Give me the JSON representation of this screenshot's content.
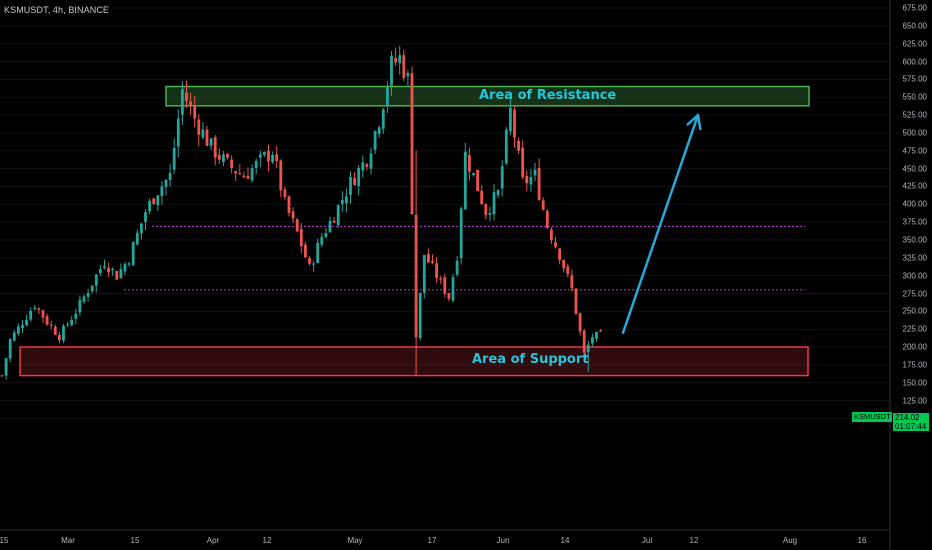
{
  "symbol": "KSMUSDT, 4h, BINANCE",
  "chart_data": {
    "type": "candlestick",
    "symbol": "KSMUSDT",
    "timeframe": "4h",
    "exchange": "BINANCE",
    "y_ticks": [
      "675.00",
      "650.00",
      "625.00",
      "600.00",
      "575.00",
      "550.00",
      "525.00",
      "500.00",
      "475.00",
      "450.00",
      "425.00",
      "400.00",
      "375.00",
      "350.00",
      "325.00",
      "300.00",
      "275.00",
      "250.00",
      "225.00",
      "200.00",
      "175.00",
      "150.00",
      "125.00",
      "100.00"
    ],
    "ylim": [
      90,
      685
    ],
    "x_ticks": [
      "15",
      "Mar",
      "15",
      "Apr",
      "12",
      "May",
      "17",
      "Jun",
      "14",
      "Jul",
      "12",
      "Aug",
      "16"
    ],
    "current_price": "214.02",
    "countdown": "01:07:44",
    "price_badge": "KSMUSDT",
    "colors": {
      "up": "#26a69a",
      "down": "#ef5350",
      "resistance": "#4caf50",
      "support": "#f23645",
      "arrow": "#26a8d8",
      "level": "#c039d8"
    },
    "zones": [
      {
        "name": "resistance",
        "label": "Area of Resistance",
        "top": 565,
        "bottom": 538
      },
      {
        "name": "support",
        "label": "Area of Support",
        "top": 200,
        "bottom": 160
      }
    ],
    "levels": [
      369,
      280
    ],
    "path_anchors": [
      [
        0,
        160
      ],
      [
        2,
        210
      ],
      [
        5,
        235
      ],
      [
        8,
        260
      ],
      [
        11,
        235
      ],
      [
        14,
        215
      ],
      [
        18,
        250
      ],
      [
        22,
        290
      ],
      [
        25,
        320
      ],
      [
        28,
        300
      ],
      [
        31,
        325
      ],
      [
        35,
        390
      ],
      [
        38,
        420
      ],
      [
        41,
        440
      ],
      [
        44,
        560
      ],
      [
        47,
        520
      ],
      [
        51,
        480
      ],
      [
        55,
        455
      ],
      [
        59,
        440
      ],
      [
        63,
        460
      ],
      [
        66,
        475
      ],
      [
        69,
        400
      ],
      [
        72,
        360
      ],
      [
        75,
        310
      ],
      [
        78,
        355
      ],
      [
        81,
        385
      ],
      [
        85,
        430
      ],
      [
        89,
        465
      ],
      [
        92,
        520
      ],
      [
        95,
        595
      ],
      [
        97,
        605
      ],
      [
        99,
        575
      ],
      [
        101,
        215
      ],
      [
        103,
        330
      ],
      [
        106,
        300
      ],
      [
        109,
        270
      ],
      [
        111,
        330
      ],
      [
        113,
        470
      ],
      [
        115,
        440
      ],
      [
        118,
        390
      ],
      [
        121,
        415
      ],
      [
        124,
        530
      ],
      [
        127,
        430
      ],
      [
        130,
        440
      ],
      [
        133,
        370
      ],
      [
        136,
        330
      ],
      [
        139,
        280
      ],
      [
        142,
        190
      ],
      [
        144,
        215
      ]
    ],
    "arrow": {
      "from": [
        146,
        220
      ],
      "to": [
        162,
        525
      ]
    }
  }
}
